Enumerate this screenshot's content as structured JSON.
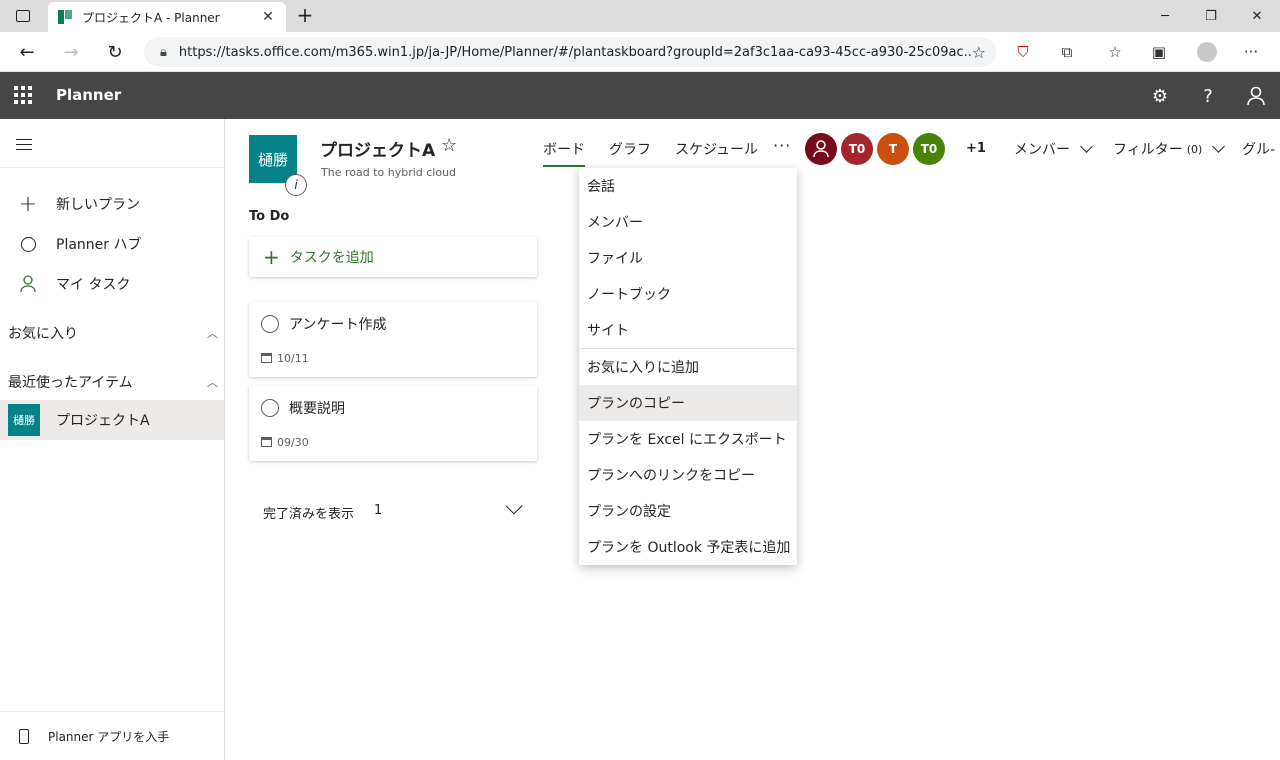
{
  "browser": {
    "tab_title": "プロジェクトA - Planner",
    "url": "https://tasks.office.com/m365.win1.jp/ja-JP/Home/Planner/#/plantaskboard?groupId=2af3c1aa-ca93-45cc-a930-25c09ac..."
  },
  "suite": {
    "app_name": "Planner"
  },
  "leftnav": {
    "items": [
      {
        "label": "新しいプラン",
        "icon": "plus-icon"
      },
      {
        "label": "Planner ハブ",
        "icon": "circle-icon"
      },
      {
        "label": "マイ タスク",
        "icon": "person-icon"
      }
    ],
    "favorites_label": "お気に入り",
    "recent_label": "最近使ったアイテム",
    "recent_items": [
      {
        "logo_text": "樋勝",
        "label": "プロジェクトA"
      }
    ],
    "get_app_label": "Planner アプリを入手"
  },
  "plan": {
    "logo_text": "樋勝",
    "title": "プロジェクトA",
    "subtitle": "The road to hybrid cloud",
    "tabs": [
      "ボード",
      "グラフ",
      "スケジュール"
    ],
    "more_label": "···",
    "members": [
      {
        "initials": "",
        "color": "#750b1c"
      },
      {
        "initials": "T0",
        "color": "#a4262c"
      },
      {
        "initials": "T",
        "color": "#ca5010"
      },
      {
        "initials": "T0",
        "color": "#498205"
      }
    ],
    "more_members": "+1",
    "members_label": "メンバー",
    "filter_label": "フィルター",
    "filter_count": "(0)",
    "group_label": "グル-"
  },
  "board": {
    "bucket_name": "To Do",
    "add_task_label": "タスクを追加",
    "tasks": [
      {
        "title": "アンケート作成",
        "date": "10/11"
      },
      {
        "title": "概要説明",
        "date": "09/30"
      }
    ],
    "completed_label": "完了済みを表示",
    "completed_count": "1"
  },
  "dropdown": {
    "group1": [
      "会話",
      "メンバー",
      "ファイル",
      "ノートブック",
      "サイト"
    ],
    "group2": [
      "お気に入りに追加",
      "プランのコピー",
      "プランを Excel にエクスポート",
      "プランへのリンクをコピー",
      "プランの設定",
      "プランを Outlook 予定表に追加"
    ],
    "hover_item": "プランのコピー"
  },
  "colors": {
    "accent": "#31752f",
    "suite_bar": "#464646",
    "plan_logo": "#038387"
  }
}
